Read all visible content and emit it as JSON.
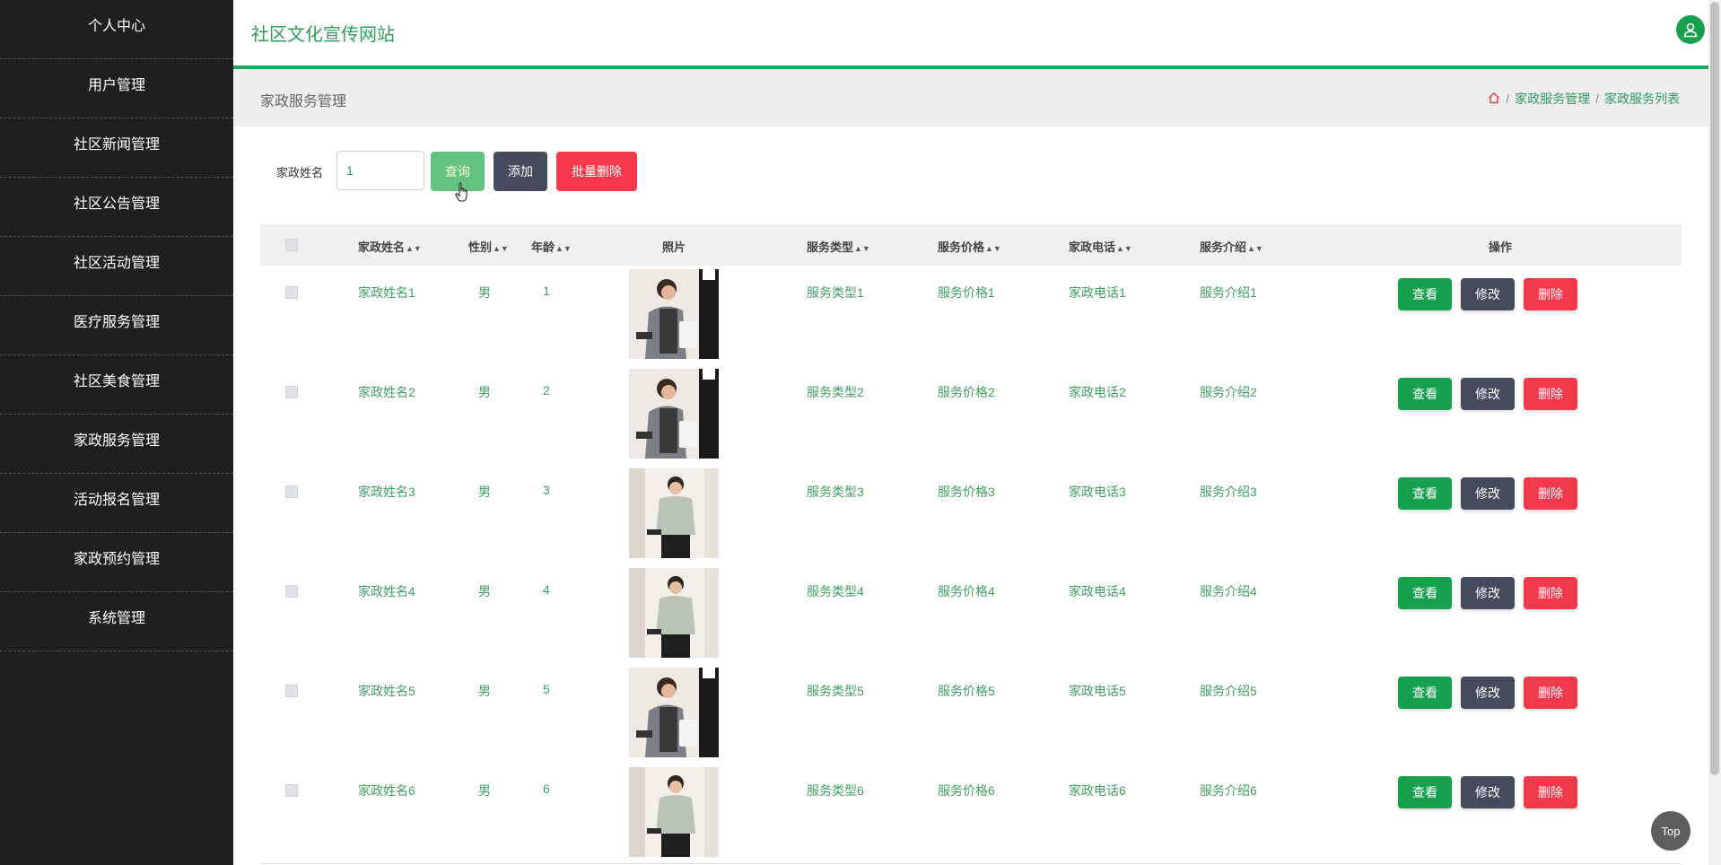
{
  "sidebar": {
    "items": [
      {
        "label": "个人中心"
      },
      {
        "label": "用户管理"
      },
      {
        "label": "社区新闻管理"
      },
      {
        "label": "社区公告管理"
      },
      {
        "label": "社区活动管理"
      },
      {
        "label": "医疗服务管理"
      },
      {
        "label": "社区美食管理"
      },
      {
        "label": "家政服务管理"
      },
      {
        "label": "活动报名管理"
      },
      {
        "label": "家政预约管理"
      },
      {
        "label": "系统管理"
      }
    ]
  },
  "header": {
    "site_title": "社区文化宣传网站",
    "avatar_icon": "user-icon"
  },
  "page_head": {
    "title": "家政服务管理",
    "breadcrumb": {
      "home_icon": "home-icon",
      "items": [
        "家政服务管理",
        "家政服务列表"
      ]
    }
  },
  "search": {
    "label": "家政姓名",
    "value": "1",
    "query_label": "查询",
    "add_label": "添加",
    "batch_delete_label": "批量删除"
  },
  "table": {
    "columns": [
      "家政姓名",
      "性别",
      "年龄",
      "照片",
      "服务类型",
      "服务价格",
      "家政电话",
      "服务介绍",
      "操作"
    ],
    "action_labels": {
      "view": "查看",
      "edit": "修改",
      "delete": "删除"
    },
    "rows": [
      {
        "name": "家政姓名1",
        "gender": "男",
        "age": "1",
        "photo": "housekeeper-apron",
        "service_type": "服务类型1",
        "price": "服务价格1",
        "phone": "家政电话1",
        "intro": "服务介绍1"
      },
      {
        "name": "家政姓名2",
        "gender": "男",
        "age": "2",
        "photo": "housekeeper-apron",
        "service_type": "服务类型2",
        "price": "服务价格2",
        "phone": "家政电话2",
        "intro": "服务介绍2"
      },
      {
        "name": "家政姓名3",
        "gender": "男",
        "age": "3",
        "photo": "housekeeper-uniform",
        "service_type": "服务类型3",
        "price": "服务价格3",
        "phone": "家政电话3",
        "intro": "服务介绍3"
      },
      {
        "name": "家政姓名4",
        "gender": "男",
        "age": "4",
        "photo": "housekeeper-uniform",
        "service_type": "服务类型4",
        "price": "服务价格4",
        "phone": "家政电话4",
        "intro": "服务介绍4"
      },
      {
        "name": "家政姓名5",
        "gender": "男",
        "age": "5",
        "photo": "housekeeper-apron",
        "service_type": "服务类型5",
        "price": "服务价格5",
        "phone": "家政电话5",
        "intro": "服务介绍5"
      },
      {
        "name": "家政姓名6",
        "gender": "男",
        "age": "6",
        "photo": "housekeeper-uniform",
        "service_type": "服务类型6",
        "price": "服务价格6",
        "phone": "家政电话6",
        "intro": "服务介绍6"
      }
    ]
  },
  "top_button": {
    "label": "Top"
  },
  "colors": {
    "accent": "#1fa45a",
    "view": "#17a04e",
    "edit": "#454a5c",
    "delete": "#f5394d",
    "sidebar_bg": "#1f1f1f",
    "cell_text": "#3f9f5f"
  }
}
